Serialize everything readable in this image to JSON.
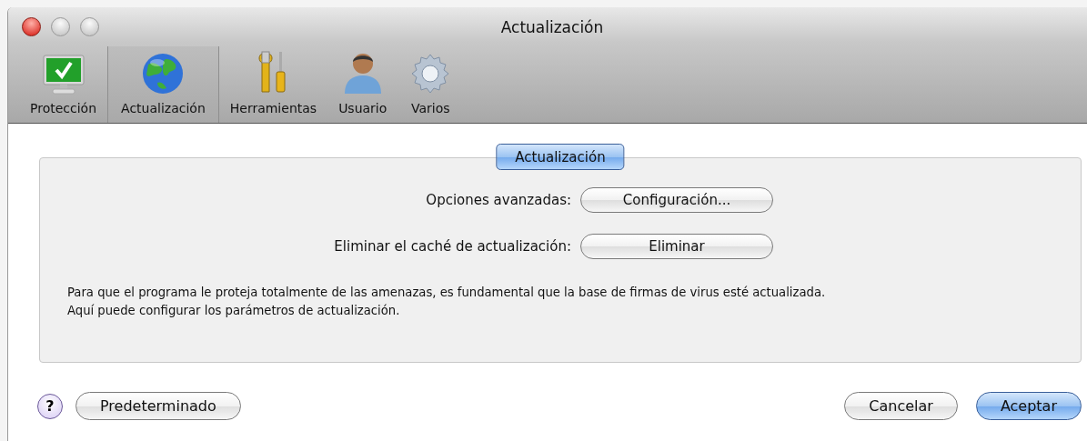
{
  "window": {
    "title": "Actualización"
  },
  "toolbar": [
    {
      "label": "Protección",
      "kind": "monitor",
      "selected": false
    },
    {
      "label": "Actualización",
      "kind": "globe",
      "selected": true
    },
    {
      "label": "Herramientas",
      "kind": "tools",
      "selected": false
    },
    {
      "label": "Usuario",
      "kind": "user",
      "selected": false
    },
    {
      "label": "Varios",
      "kind": "gear",
      "selected": false
    }
  ],
  "group": {
    "title": "Actualización",
    "rows": [
      {
        "label": "Opciones avanzadas:",
        "button": "Configuración..."
      },
      {
        "label": "Eliminar el caché de actualización:",
        "button": "Eliminar"
      }
    ],
    "description": [
      "Para que el programa le proteja totalmente de las amenazas, es fundamental que la base de firmas de virus esté actualizada.",
      "Aquí puede configurar los parámetros de actualización."
    ]
  },
  "footer": {
    "help": "?",
    "left_buttons": [
      {
        "label": "Predeterminado",
        "default": false
      }
    ],
    "right_buttons": [
      {
        "label": "Cancelar",
        "default": false
      },
      {
        "label": "Aceptar",
        "default": true
      }
    ]
  }
}
